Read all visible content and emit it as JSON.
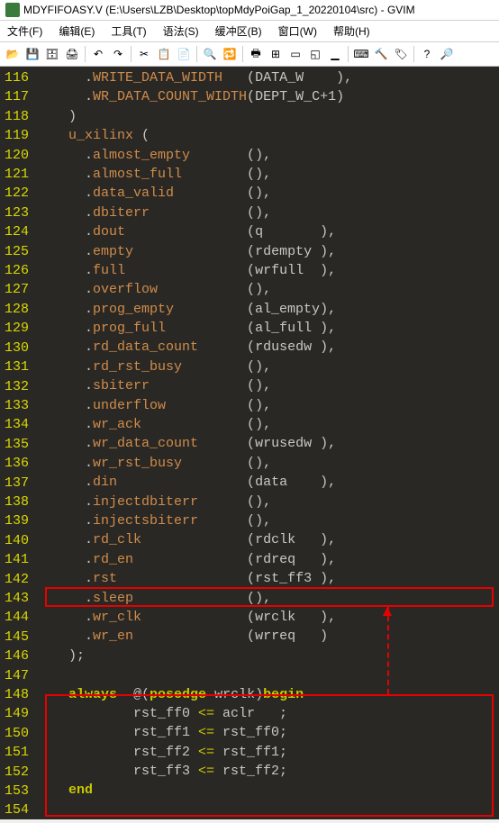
{
  "window": {
    "title": "MDYFIFOASY.V (E:\\Users\\LZB\\Desktop\\topMdyPoiGap_1_20220104\\src) - GVIM"
  },
  "menubar": {
    "items": [
      "文件(F)",
      "编辑(E)",
      "工具(T)",
      "语法(S)",
      "缓冲区(B)",
      "窗口(W)",
      "帮助(H)"
    ]
  },
  "toolbar": {
    "icons": [
      "open",
      "save",
      "saveall",
      "print",
      "sep",
      "undo",
      "redo",
      "sep",
      "cut",
      "copy",
      "paste",
      "sep",
      "find",
      "findnext",
      "sep",
      "replace",
      "newwin",
      "split",
      "maxwin",
      "minwin",
      "sep",
      "shell",
      "make",
      "tags",
      "sep",
      "help",
      "findhelp"
    ]
  },
  "gutter": {
    "start": 116,
    "end": 154
  },
  "code_lines": [
    {
      "n": 116,
      "t": "      .",
      "p": "WRITE_DATA_WIDTH",
      "r": "   (",
      "a": "DATA_W",
      "e": "    ),"
    },
    {
      "n": 117,
      "t": "      .",
      "p": "WR_DATA_COUNT_WIDTH",
      "r": "(",
      "a": "DEPT_W_C+1",
      "e": ")"
    },
    {
      "n": 118,
      "t": "    )",
      "p": "",
      "r": "",
      "a": "",
      "e": ""
    },
    {
      "n": 119,
      "t": "    ",
      "p": "u_xilinx",
      "r": " (",
      "a": "",
      "e": ""
    },
    {
      "n": 120,
      "t": "      .",
      "p": "almost_empty",
      "r": "       (",
      "a": "",
      "e": "),"
    },
    {
      "n": 121,
      "t": "      .",
      "p": "almost_full",
      "r": "        (",
      "a": "",
      "e": "),"
    },
    {
      "n": 122,
      "t": "      .",
      "p": "data_valid",
      "r": "         (",
      "a": "",
      "e": "),"
    },
    {
      "n": 123,
      "t": "      .",
      "p": "dbiterr",
      "r": "            (",
      "a": "",
      "e": "),"
    },
    {
      "n": 124,
      "t": "      .",
      "p": "dout",
      "r": "               (",
      "a": "q",
      "e": "       ),"
    },
    {
      "n": 125,
      "t": "      .",
      "p": "empty",
      "r": "              (",
      "a": "rdempty",
      "e": " ),"
    },
    {
      "n": 126,
      "t": "      .",
      "p": "full",
      "r": "               (",
      "a": "wrfull",
      "e": "  ),"
    },
    {
      "n": 127,
      "t": "      .",
      "p": "overflow",
      "r": "           (",
      "a": "",
      "e": "),"
    },
    {
      "n": 128,
      "t": "      .",
      "p": "prog_empty",
      "r": "         (",
      "a": "al_empty",
      "e": "),"
    },
    {
      "n": 129,
      "t": "      .",
      "p": "prog_full",
      "r": "          (",
      "a": "al_full",
      "e": " ),"
    },
    {
      "n": 130,
      "t": "      .",
      "p": "rd_data_count",
      "r": "      (",
      "a": "rdusedw",
      "e": " ),"
    },
    {
      "n": 131,
      "t": "      .",
      "p": "rd_rst_busy",
      "r": "        (",
      "a": "",
      "e": "),"
    },
    {
      "n": 132,
      "t": "      .",
      "p": "sbiterr",
      "r": "            (",
      "a": "",
      "e": "),"
    },
    {
      "n": 133,
      "t": "      .",
      "p": "underflow",
      "r": "          (",
      "a": "",
      "e": "),"
    },
    {
      "n": 134,
      "t": "      .",
      "p": "wr_ack",
      "r": "             (",
      "a": "",
      "e": "),"
    },
    {
      "n": 135,
      "t": "      .",
      "p": "wr_data_count",
      "r": "      (",
      "a": "wrusedw",
      "e": " ),"
    },
    {
      "n": 136,
      "t": "      .",
      "p": "wr_rst_busy",
      "r": "        (",
      "a": "",
      "e": "),"
    },
    {
      "n": 137,
      "t": "      .",
      "p": "din",
      "r": "                (",
      "a": "data",
      "e": "    ),"
    },
    {
      "n": 138,
      "t": "      .",
      "p": "injectdbiterr",
      "r": "      (",
      "a": "",
      "e": "),"
    },
    {
      "n": 139,
      "t": "      .",
      "p": "injectsbiterr",
      "r": "      (",
      "a": "",
      "e": "),"
    },
    {
      "n": 140,
      "t": "      .",
      "p": "rd_clk",
      "r": "             (",
      "a": "rdclk",
      "e": "   ),"
    },
    {
      "n": 141,
      "t": "      .",
      "p": "rd_en",
      "r": "              (",
      "a": "rdreq",
      "e": "   ),"
    },
    {
      "n": 142,
      "t": "      .",
      "p": "rst",
      "r": "                (",
      "a": "rst_ff3",
      "e": " ),"
    },
    {
      "n": 143,
      "t": "      .",
      "p": "sleep",
      "r": "              (",
      "a": "",
      "e": "),"
    },
    {
      "n": 144,
      "t": "      .",
      "p": "wr_clk",
      "r": "             (",
      "a": "wrclk",
      "e": "   ),"
    },
    {
      "n": 145,
      "t": "      .",
      "p": "wr_en",
      "r": "              (",
      "a": "wrreq",
      "e": "   )"
    },
    {
      "n": 146,
      "t": "    );",
      "p": "",
      "r": "",
      "a": "",
      "e": ""
    },
    {
      "n": 147,
      "t": "",
      "p": "",
      "r": "",
      "a": "",
      "e": ""
    },
    {
      "n": 148,
      "kw": "always",
      "mid": "  @(",
      "kw2": "posedge",
      "rest": " wrclk)",
      "kw3": "begin"
    },
    {
      "n": 149,
      "assign": true,
      "lhs": "rst_ff0",
      "rhs": "aclr   ;"
    },
    {
      "n": 150,
      "assign": true,
      "lhs": "rst_ff1",
      "rhs": "rst_ff0;"
    },
    {
      "n": 151,
      "assign": true,
      "lhs": "rst_ff2",
      "rhs": "rst_ff1;"
    },
    {
      "n": 152,
      "assign": true,
      "lhs": "rst_ff3",
      "rhs": "rst_ff2;"
    },
    {
      "n": 153,
      "kw": "end",
      "mid": "",
      "kw2": "",
      "rest": "",
      "kw3": ""
    },
    {
      "n": 154,
      "t": "",
      "p": "",
      "r": "",
      "a": "",
      "e": ""
    }
  ]
}
